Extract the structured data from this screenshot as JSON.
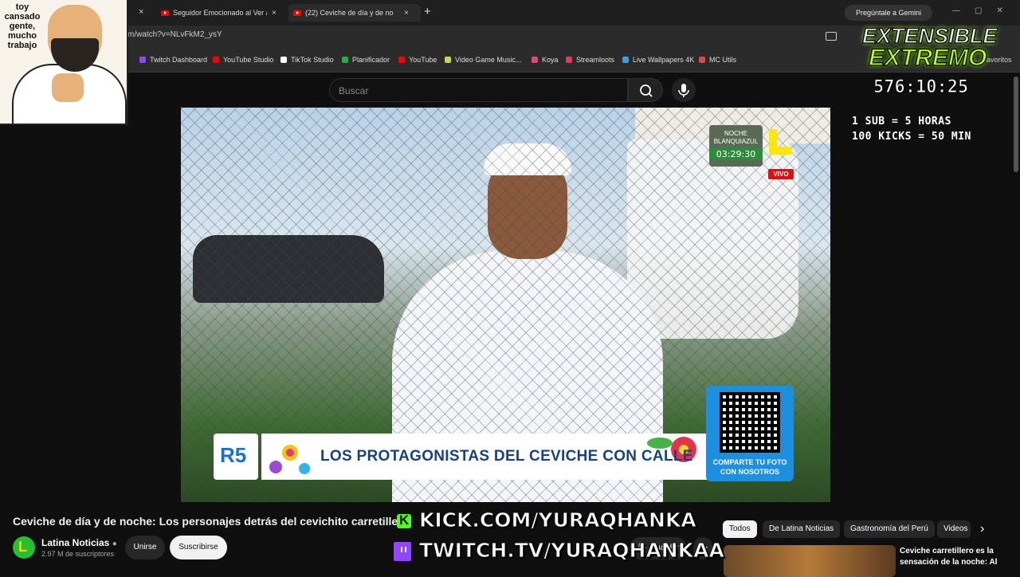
{
  "browser": {
    "tabs": [
      {
        "title": "Seguidor Emocionado al Ver a"
      },
      {
        "title": "(22) Ceviche de día y de no"
      }
    ],
    "new_tab": "+",
    "close": "×",
    "gemini": "Pregúntale a Gemini",
    "url": "m/watch?v=NLvFkM2_ysY",
    "bookmarks": [
      {
        "label": "Twitch Dashboard",
        "color": "#9146ff"
      },
      {
        "label": "YouTube Studio",
        "color": "#ff0000"
      },
      {
        "label": "TikTok Studio",
        "color": "#ffffff"
      },
      {
        "label": "Planificador",
        "color": "#1fb141"
      },
      {
        "label": "YouTube",
        "color": "#ff0000"
      },
      {
        "label": "Video Game Music...",
        "color": "#c8d84a"
      },
      {
        "label": "Koya",
        "color": "#e04a70"
      },
      {
        "label": "Streamloots",
        "color": "#e03a5a"
      },
      {
        "label": "Live Wallpapers 4K",
        "color": "#3aa0e0"
      },
      {
        "label": "MC Utils",
        "color": "#d84a4a"
      }
    ],
    "favoritos": "avoritos"
  },
  "youtube": {
    "search_placeholder": "Buscar",
    "video_title": "Ceviche de día y de noche: Los personajes detrás del cevichito carretillero",
    "channel": {
      "name": "Latina Noticias",
      "subs": "2.97 M de suscriptores",
      "avatar_letter": "L"
    },
    "join": "Unirse",
    "subscribe": "Suscribirse",
    "save": "Guardar",
    "chips": [
      "Todos",
      "De Latina Noticias",
      "Gastronomía del Perú",
      "Videos"
    ],
    "related_title": "Ceviche carretillero es la sensación de la noche: Al"
  },
  "video_overlay": {
    "badge_line1": "NOCHE",
    "badge_line2": "BLANQUIAZUL",
    "badge_time": "03:29:30",
    "live": "VIVO",
    "lower_third_logo": "R5",
    "lower_third": "LOS PROTAGONISTAS DEL CEVICHE CON CALLE",
    "qr_text": "COMPARTE TU FOTO CON NOSOTROS"
  },
  "stream_overlay": {
    "webcam_caption": "toy cansado gente, mucho trabajo",
    "brand_line1": "EXTENSIBLE",
    "brand_line2": "EXTREMO",
    "timer": "576:10:25",
    "rule1": "1 SUB = 5 HORAS",
    "rule2": "100 KICKS = 50 MIN",
    "kick": "KICK.COM/YURAQHANKA",
    "twitch": "TWITCH.TV/YURAQHANKAA"
  }
}
